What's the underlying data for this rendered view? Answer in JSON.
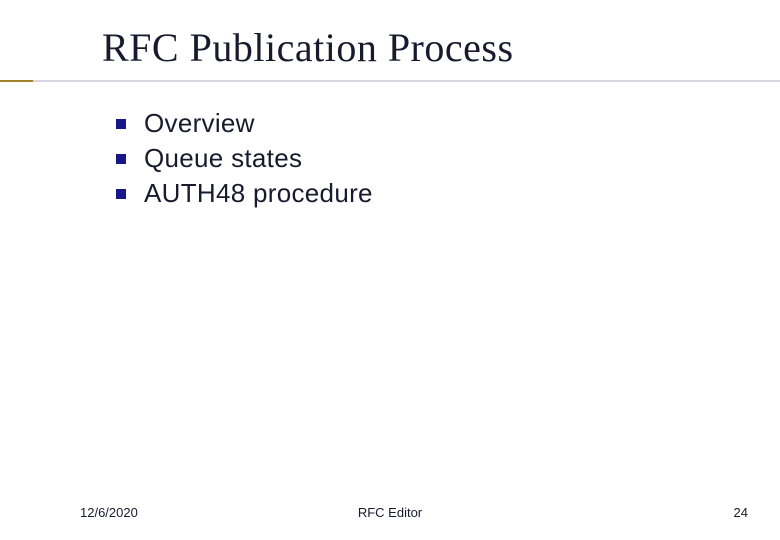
{
  "title": "RFC Publication Process",
  "bullets": [
    {
      "text": "Overview"
    },
    {
      "text": "Queue states"
    },
    {
      "text": "AUTH48 procedure"
    }
  ],
  "footer": {
    "date": "12/6/2020",
    "center": "RFC Editor",
    "page": "24"
  }
}
